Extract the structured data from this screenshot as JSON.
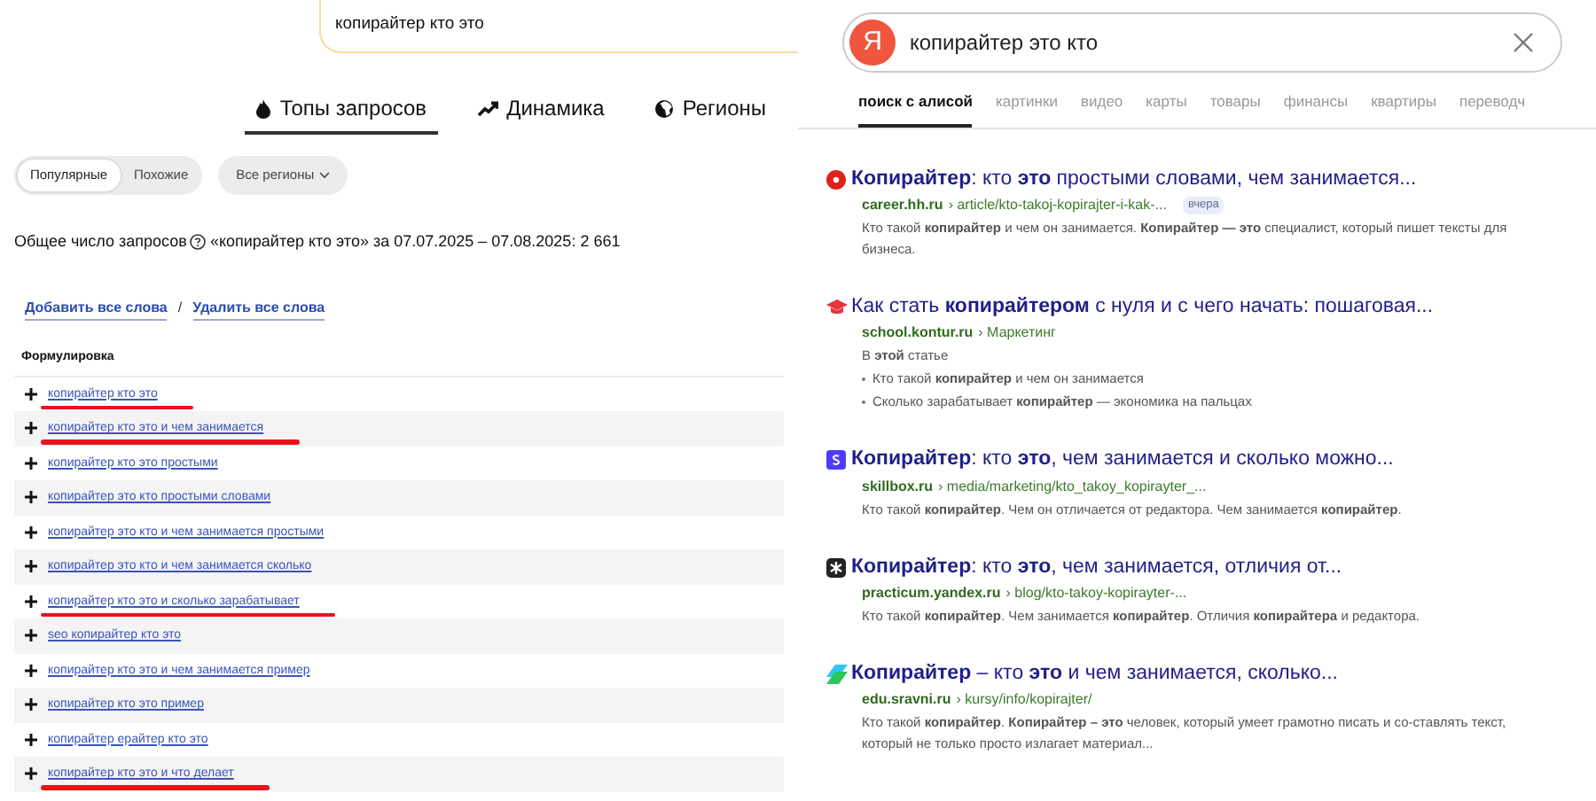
{
  "wordstat": {
    "search": {
      "value": "копирайтер кто это"
    },
    "tabs": [
      {
        "label": "Топы запросов",
        "selected": true
      },
      {
        "label": "Динамика",
        "selected": false
      },
      {
        "label": "Регионы",
        "selected": false
      }
    ],
    "mode_toggle": [
      {
        "label": "Популярные",
        "selected": true
      },
      {
        "label": "Похожие",
        "selected": false
      }
    ],
    "region_dropdown": {
      "label": "Все регионы"
    },
    "summary": {
      "label": "Общее число запросов",
      "text": "«копирайтер кто это» за 07.07.2025 – 07.08.2025: 2 661"
    },
    "actions": {
      "add": "Добавить все слова",
      "separator": "/",
      "remove": "Удалить все слова"
    },
    "table": {
      "column": "Формулировка",
      "rows": [
        {
          "phrase": "копирайтер кто это",
          "marked": true
        },
        {
          "phrase": "копирайтер кто это и чем занимается",
          "marked": true
        },
        {
          "phrase": "копирайтер кто это простыми",
          "marked": false
        },
        {
          "phrase": "копирайтер это кто простыми словами",
          "marked": false
        },
        {
          "phrase": "копирайтер это кто и чем занимается простыми",
          "marked": false
        },
        {
          "phrase": "копирайтер это кто и чем занимается сколько",
          "marked": false
        },
        {
          "phrase": "копирайтер кто это и сколько зарабатывает",
          "marked": true
        },
        {
          "phrase": "seo копирайтер кто это",
          "marked": false
        },
        {
          "phrase": "копирайтер кто это и чем занимается пример",
          "marked": false
        },
        {
          "phrase": "копирайтер кто это пример",
          "marked": false
        },
        {
          "phrase": "копирайтер ерайтер кто это",
          "marked": false
        },
        {
          "phrase": "копирайтер кто это и что делает",
          "marked": true
        }
      ]
    }
  },
  "yandex": {
    "logo": "Я",
    "search": {
      "value": "копирайтер это кто"
    },
    "tabs": [
      {
        "label": "поиск с алисой",
        "selected": true
      },
      {
        "label": "картинки",
        "selected": false
      },
      {
        "label": "видео",
        "selected": false
      },
      {
        "label": "карты",
        "selected": false
      },
      {
        "label": "товары",
        "selected": false
      },
      {
        "label": "финансы",
        "selected": false
      },
      {
        "label": "квартиры",
        "selected": false
      },
      {
        "label": "переводч",
        "selected": false
      }
    ],
    "results": [
      {
        "kind": "hh",
        "title": "**Копирайтер**: кто **это** простыми словами, чем занимается...",
        "domain": "career.hh.ru",
        "path": "› article/kto-takoj-kopirajter-i-kak-...",
        "badge": "вчера",
        "snippet": "Кто такой **копирайтер** и чем он занимается. **Копирайтер — это** специалист, который пишет тексты для бизнеса."
      },
      {
        "kind": "kontur",
        "title": "Как стать **копирайтером** с нуля и с чего начать: пошаговая...",
        "domain": "school.kontur.ru",
        "path": "› Маркетинг",
        "snippet": "В **этой** статье",
        "bullets": [
          "Кто такой **копирайтер** и чем он занимается",
          "Сколько зарабатывает **копирайтер** — экономика на пальцах"
        ]
      },
      {
        "kind": "skillbox",
        "title": "**Копирайтер**: кто **это**, чем занимается и сколько можно...",
        "domain": "skillbox.ru",
        "path": "› media/marketing/kto_takoy_kopirayter_...",
        "snippet": "Кто такой **копирайтер**. Чем он отличается от редактора. Чем занимается **копирайтер**."
      },
      {
        "kind": "practicum",
        "title": "**Копирайтер**: кто **это**, чем занимается, отличия от...",
        "domain": "practicum.yandex.ru",
        "path": "› blog/kto-takoy-kopirayter-...",
        "snippet": "Кто такой **копирайтер**. Чем занимается **копирайтер**. Отличия **копирайтера** и редактора."
      },
      {
        "kind": "sravni",
        "title": "**Копирайтер** – кто **это** и чем занимается, сколько...",
        "domain": "edu.sravni.ru",
        "path": "› kursy/info/kopirajter/",
        "snippet": "Кто такой **копирайтер**. **Копирайтер – это** человек, который умеет грамотно писать и со-ставлять текст, который не только просто излагает материал..."
      }
    ]
  }
}
